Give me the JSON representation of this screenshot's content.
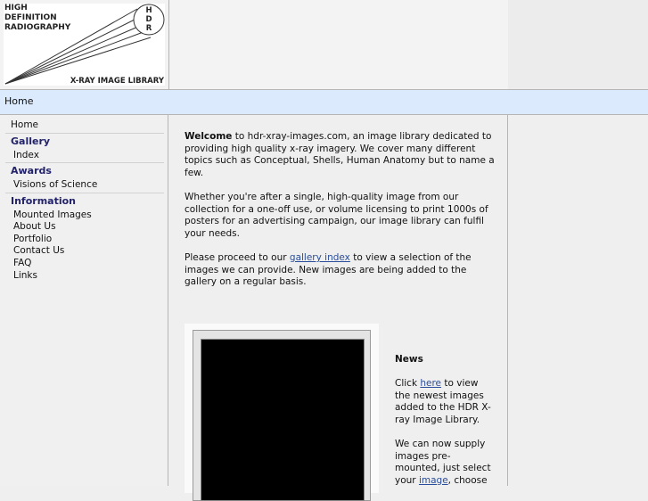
{
  "logo": {
    "line1": "HIGH",
    "line2": "DEFINITION",
    "line3": "RADIOGRAPHY",
    "badge_letters": [
      "H",
      "D",
      "R"
    ],
    "tagline": "X-RAY IMAGE LIBRARY"
  },
  "breadcrumb": {
    "label": "Home"
  },
  "sidebar": {
    "home": "Home",
    "sections": [
      {
        "heading": "Gallery",
        "items": [
          "Index"
        ]
      },
      {
        "heading": "Awards",
        "items": [
          "Visions of Science"
        ]
      },
      {
        "heading": "Information",
        "items": [
          "Mounted Images",
          "About Us",
          "Portfolio",
          "Contact Us",
          "FAQ",
          "Links"
        ]
      }
    ]
  },
  "main": {
    "welcome_bold": "Welcome",
    "welcome_rest": " to hdr-xray-images.com, an image library dedicated to providing high quality x-ray imagery. We cover many different topics such as Conceptual, Shells, Human Anatomy but to name a few.",
    "para2": "Whether you're after a single, high-quality image from our collection for a one-off use, or volume licensing to print 1000s of posters for an advertising campaign, our image library can fulfil your needs.",
    "para3_before": "Please proceed to our ",
    "para3_link": "gallery index",
    "para3_after": " to view a selection of the images we can provide. New images are being added to the gallery on a regular basis."
  },
  "news": {
    "heading": "News",
    "p1_before": "Click ",
    "p1_link": "here",
    "p1_after": " to view the newest images added to the HDR X-ray Image Library.",
    "p2_before": "We can now supply images pre-mounted, just select your ",
    "p2_link": "image",
    "p2_after": ", choose"
  }
}
